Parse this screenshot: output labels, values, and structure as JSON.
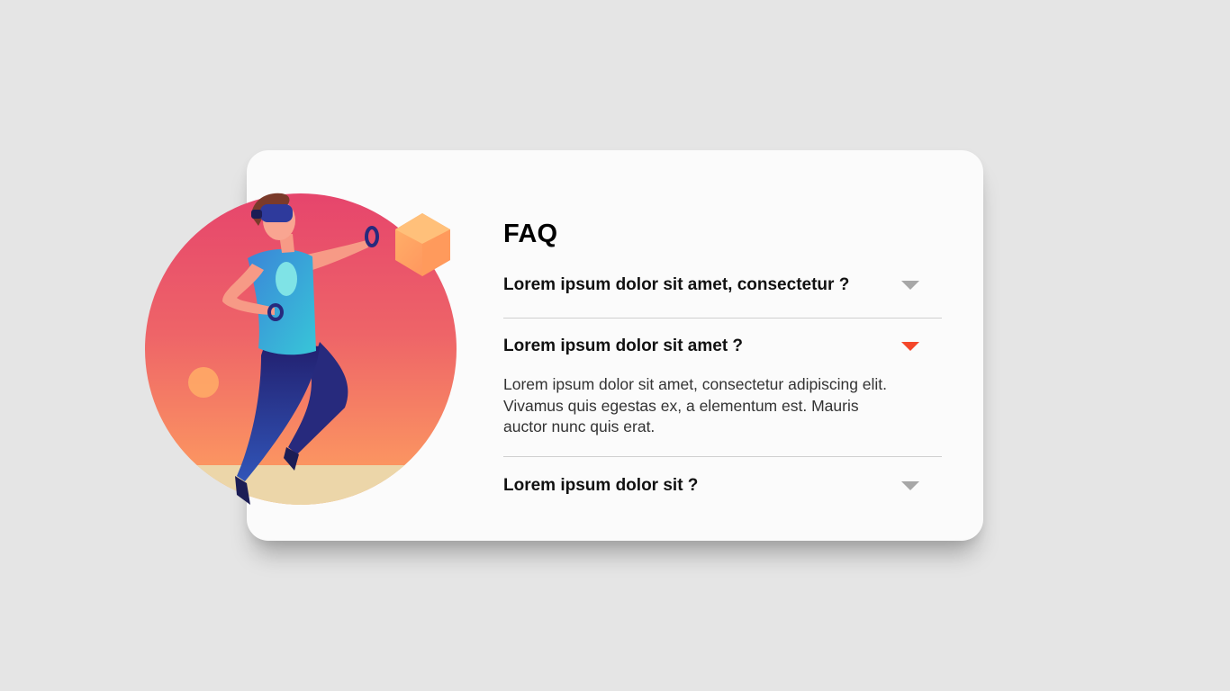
{
  "faq": {
    "title": "FAQ",
    "items": [
      {
        "question": "Lorem ipsum dolor sit amet, consectetur ?",
        "expanded": false
      },
      {
        "question": "Lorem ipsum dolor sit amet ?",
        "expanded": true,
        "answer": "Lorem ipsum dolor sit amet, consectetur adipiscing elit. Vivamus quis egestas ex, a elementum est. Mauris auctor nunc quis erat."
      },
      {
        "question": "Lorem ipsum dolor sit ?",
        "expanded": false
      }
    ]
  },
  "illustration": {
    "subject": "person-wearing-vr-headset-icon",
    "colors": {
      "circle_top": "#e6456c",
      "circle_bottom": "#ffa35f",
      "ground": "#ecd6a9",
      "shirt": "#3aa6dc",
      "pants": "#262878",
      "cube": "#ffa15e"
    }
  },
  "colors": {
    "background": "#e5e5e5",
    "card": "#fbfbfb",
    "arrow_closed": "#a7a7a7",
    "arrow_open": "#f4472a"
  }
}
